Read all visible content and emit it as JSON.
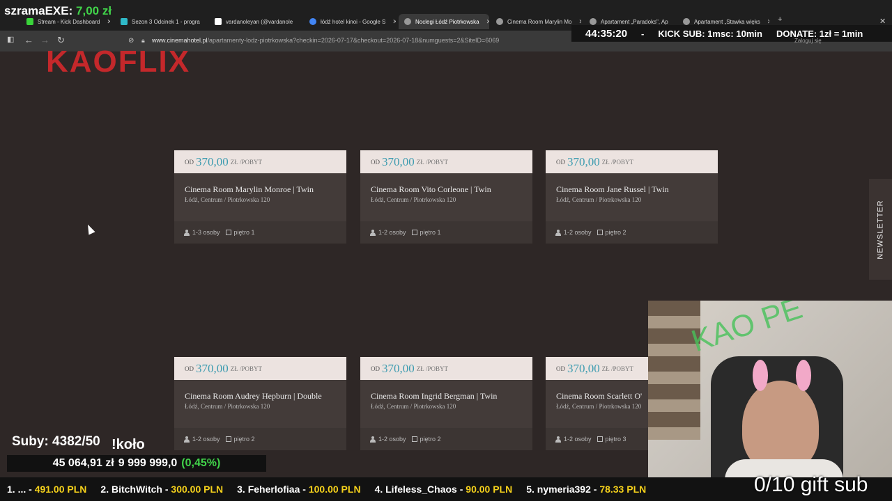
{
  "streamer": {
    "name": "szramaEXE:",
    "amount": "7,00 zł"
  },
  "tabs": [
    {
      "label": "Stream - Kick Dashboard",
      "fav": "#3ad43a"
    },
    {
      "label": "Sezon 3 Odcinek 1 - progra",
      "fav": "#2fb9c8"
    },
    {
      "label": "vardanoleyan (@vardanole",
      "fav": "#ffffff"
    },
    {
      "label": "łódź hotel kinoi - Google S",
      "fav": "#4285f4"
    },
    {
      "label": "Noclegi Łódź Piotrkowska",
      "fav": "#999999",
      "active": true
    },
    {
      "label": "Cinema Room Marylin Mo",
      "fav": "#999999"
    },
    {
      "label": "Apartament „Paradoks\", Ap",
      "fav": "#999999"
    },
    {
      "label": "Apartament „Stawka więks",
      "fav": "#999999"
    }
  ],
  "address": {
    "domain": "www.cinemahotel.pl",
    "path": "/apartamenty-lodz-piotrkowska?checkin=2026-07-17&checkout=2026-07-18&numguests=2&SiteID=6069",
    "profile": "Zaloguj się"
  },
  "overlay_top": {
    "timer": "44:35:20",
    "sep": "-",
    "kick_sub": "KICK SUB: 1msc: 10min",
    "donate": "DONATE: 1zł = 1min"
  },
  "logo": "KAOFLIX",
  "price_prefix": "OD",
  "price_unit": "ZŁ /POBYT",
  "cards": [
    {
      "price": "370,00",
      "title": "Cinema Room Marylin Monroe | Twin",
      "location": "Łódź, Centrum / Piotrkowska 120",
      "guests": "1-3 osoby",
      "floor": "piętro 1"
    },
    {
      "price": "370,00",
      "title": "Cinema Room Vito Corleone | Twin",
      "location": "Łódź, Centrum / Piotrkowska 120",
      "guests": "1-2 osoby",
      "floor": "piętro 1"
    },
    {
      "price": "370,00",
      "title": "Cinema Room Jane Russel | Twin",
      "location": "Łódź, Centrum / Piotrkowska 120",
      "guests": "1-2 osoby",
      "floor": "piętro 2"
    },
    {
      "price": "370,00",
      "title": "Cinema Room Audrey Hepburn | Double",
      "location": "Łódź, Centrum / Piotrkowska 120",
      "guests": "1-2 osoby",
      "floor": "piętro 2"
    },
    {
      "price": "370,00",
      "title": "Cinema Room Ingrid Bergman | Twin",
      "location": "Łódź, Centrum / Piotrkowska 120",
      "guests": "1-2 osoby",
      "floor": "piętro 2"
    },
    {
      "price": "370,00",
      "title": "Cinema Room Scarlett O'",
      "location": "Łódź, Centrum / Piotrkowska 120",
      "guests": "1-2 osoby",
      "floor": "piętro 3"
    }
  ],
  "newsletter": "NEWSLETTER",
  "subs": "Suby: 4382/50",
  "kolo": "!koło",
  "goal": {
    "current": "45 064,91 zł",
    "target": "9 999 999,0",
    "percent": "(0,45%)"
  },
  "ticker": [
    {
      "name": "1. ...",
      "amount": "491.00 PLN"
    },
    {
      "name": "2. BitchWitch",
      "amount": "300.00 PLN"
    },
    {
      "name": "3. Feherlofiaa",
      "amount": "100.00 PLN"
    },
    {
      "name": "4. Lifeless_Chaos",
      "amount": "90.00 PLN"
    },
    {
      "name": "5. nymeria392",
      "amount": "78.33 PLN"
    }
  ],
  "gift_sub": "0/10 gift sub",
  "webcam_sign": "KAO PE"
}
